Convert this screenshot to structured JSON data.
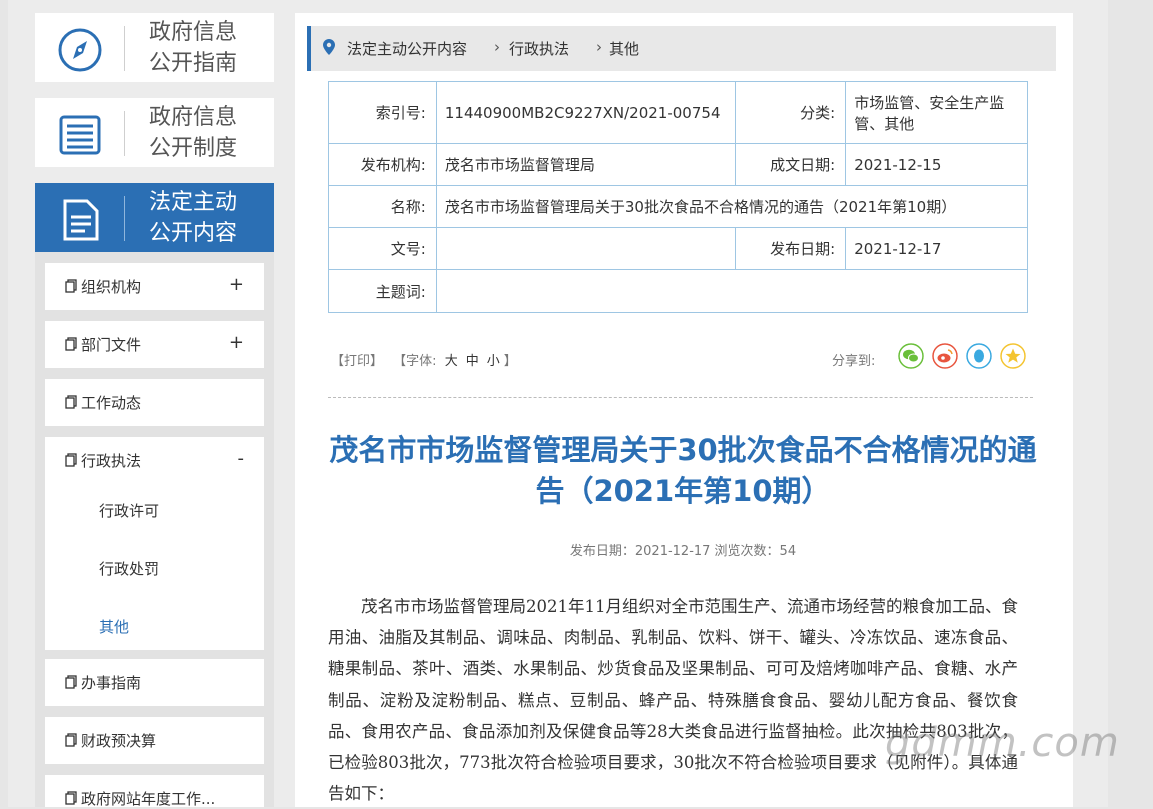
{
  "sidebar": {
    "cards": [
      {
        "line1": "政府信息",
        "line2": "公开指南",
        "icon": "compass-icon"
      },
      {
        "line1": "政府信息",
        "line2": "公开制度",
        "icon": "list-icon"
      },
      {
        "line1": "法定主动",
        "line2": "公开内容",
        "icon": "document-icon"
      }
    ],
    "nav": [
      {
        "label": "组织机构",
        "sign": "+"
      },
      {
        "label": "部门文件",
        "sign": "+"
      },
      {
        "label": "工作动态",
        "sign": ""
      },
      {
        "label": "行政执法",
        "sign": "-"
      },
      {
        "label": "办事指南",
        "sign": ""
      },
      {
        "label": "财政预决算",
        "sign": ""
      },
      {
        "label": "政府网站年度工作...",
        "sign": ""
      }
    ],
    "subnav": [
      "行政许可",
      "行政处罚",
      "其他"
    ]
  },
  "breadcrumb": [
    "法定主动公开内容",
    "行政执法",
    "其他"
  ],
  "meta": {
    "index_label": "索引号:",
    "index_value": "11440900MB2C9227XN/2021-00754",
    "category_label": "分类:",
    "category_value": "市场监管、安全生产监管、其他",
    "org_label": "发布机构:",
    "org_value": "茂名市市场监督管理局",
    "date_label": "成文日期:",
    "date_value": "2021-12-15",
    "name_label": "名称:",
    "name_value": "茂名市市场监督管理局关于30批次食品不合格情况的通告（2021年第10期）",
    "docno_label": "文号:",
    "docno_value": "",
    "pubdate_label": "发布日期:",
    "pubdate_value": "2021-12-17",
    "keywords_label": "主题词:",
    "keywords_value": ""
  },
  "tools": {
    "print": "【打印】",
    "font_prefix": "【字体:",
    "big": "大",
    "mid": "中",
    "small": "小",
    "font_suffix": "】",
    "share_label": "分享到:"
  },
  "article": {
    "title": "茂名市市场监督管理局关于30批次食品不合格情况的通告（2021年第10期）",
    "info": "发布日期：2021-12-17  浏览次数：54",
    "body": "茂名市市场监督管理局2021年11月组织对全市范围生产、流通市场经营的粮食加工品、食用油、油脂及其制品、调味品、肉制品、乳制品、饮料、饼干、罐头、冷冻饮品、速冻食品、糖果制品、茶叶、酒类、水果制品、炒货食品及坚果制品、可可及焙烤咖啡产品、食糖、水产制品、淀粉及淀粉制品、糕点、豆制品、蜂产品、特殊膳食食品、婴幼儿配方食品、餐饮食品、食用农产品、食品添加剂及保健食品等28大类食品进行监督抽检。此次抽检共803批次，已检验803批次，773批次符合检验项目要求，30批次不符合检验项目要求（见附件）。具体通告如下："
  },
  "watermark": "gdmm.com",
  "colors": {
    "accent": "#2b6fb4",
    "wechat": "#6abf3a",
    "weibo": "#e8553e",
    "qq": "#3aa9e0",
    "qzone": "#f4c430"
  }
}
